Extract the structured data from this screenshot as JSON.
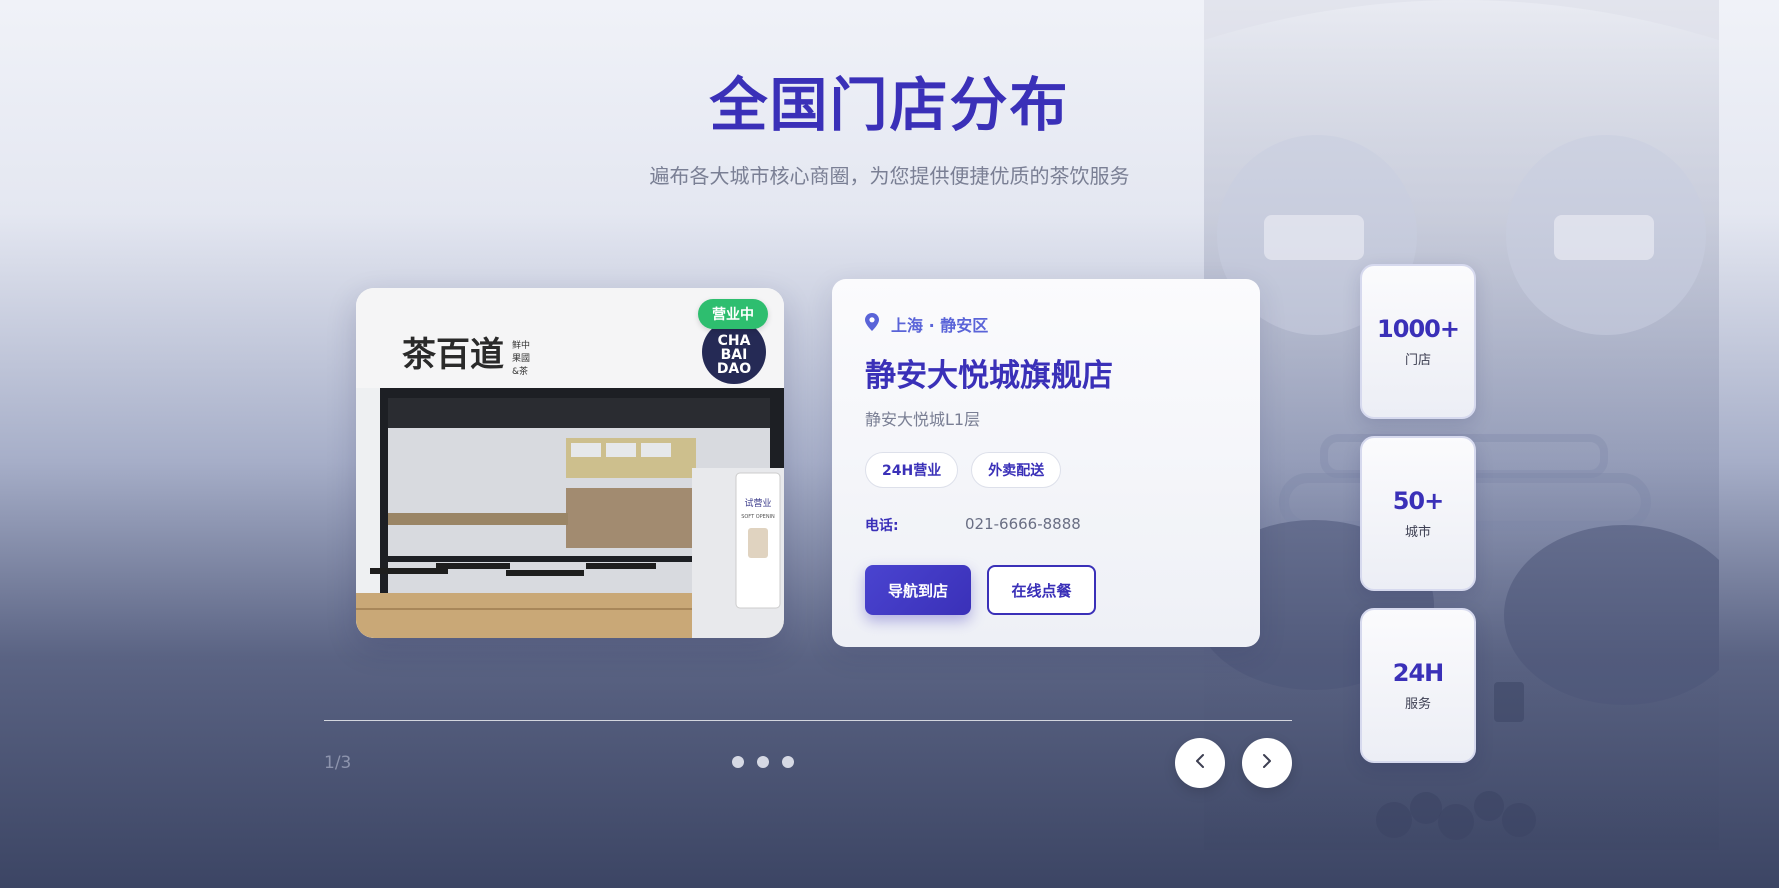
{
  "header": {
    "title": "全国门店分布",
    "subtitle": "遍布各大城市核心商圈，为您提供便捷优质的茶饮服务"
  },
  "store": {
    "status_badge": "营业中",
    "location": "上海 · 静安区",
    "name": "静安大悦城旗舰店",
    "address": "静安大悦城L1层",
    "tags": [
      "24H营业",
      "外卖配送"
    ],
    "phone_label": "电话:",
    "phone": "021-6666-8888",
    "navigate_label": "导航到店",
    "order_label": "在线点餐",
    "photo": {
      "brand_text": "茶百道",
      "brand_side_text": [
        "鲜中",
        "果國",
        "&茶"
      ],
      "logo_text": [
        "CHA",
        "BAI",
        "DAO"
      ],
      "poster_text": [
        "试营业",
        "SOFT OPENIN"
      ]
    }
  },
  "stats": [
    {
      "value": "1000+",
      "label": "门店"
    },
    {
      "value": "50+",
      "label": "城市"
    },
    {
      "value": "24H",
      "label": "服务"
    }
  ],
  "carousel": {
    "page_indicator": "1/3",
    "current_index": 1,
    "total": 3
  },
  "icons": {
    "location": "location-pin-icon",
    "prev": "chevron-left-icon",
    "next": "chevron-right-icon"
  },
  "colors": {
    "primary": "#3a30b8",
    "accent": "#5a64d8",
    "open_badge": "#2ebe6f"
  }
}
